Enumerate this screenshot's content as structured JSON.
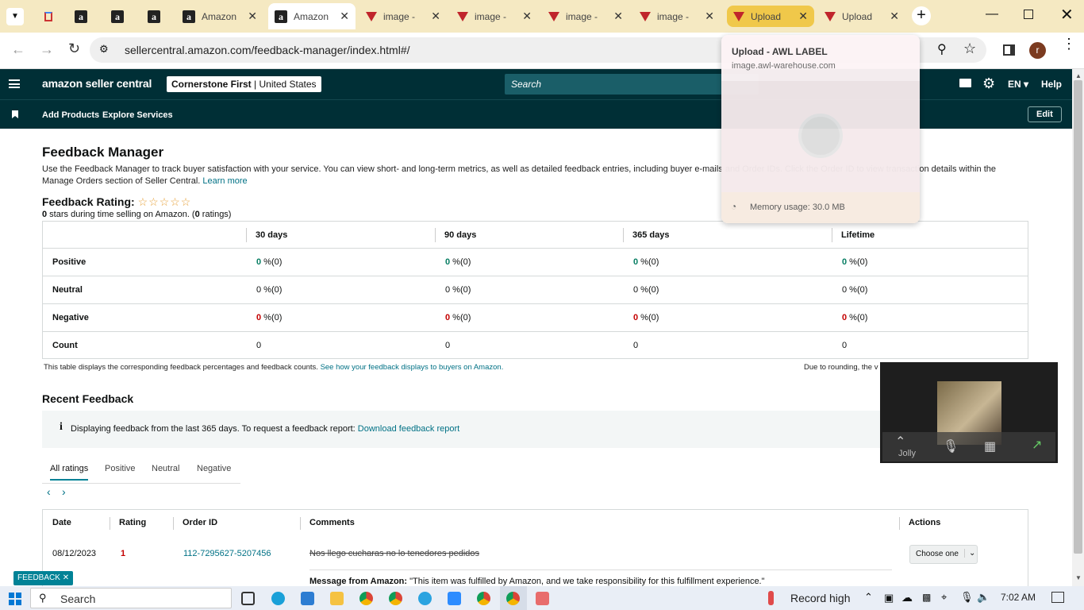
{
  "browser": {
    "tabs": [
      {
        "label": "",
        "icon": "gmail-icon"
      },
      {
        "label": "",
        "icon": "amazon-icon"
      },
      {
        "label": "",
        "icon": "amazon-icon"
      },
      {
        "label": "",
        "icon": "amazon-icon"
      },
      {
        "label": "Amazon",
        "icon": "amazon-icon"
      },
      {
        "label": "Amazon",
        "icon": "amazon-icon",
        "active": true
      },
      {
        "label": "image -",
        "icon": "awl-icon"
      },
      {
        "label": "image -",
        "icon": "awl-icon"
      },
      {
        "label": "image -",
        "icon": "awl-icon"
      },
      {
        "label": "image -",
        "icon": "awl-icon"
      },
      {
        "label": "Upload",
        "icon": "awl-icon",
        "highlighted": true
      },
      {
        "label": "Upload",
        "icon": "awl-icon"
      }
    ],
    "url": "sellercentral.amazon.com/feedback-manager/index.html#/",
    "profile_initial": "r"
  },
  "tab_preview": {
    "title": "Upload - AWL LABEL",
    "domain": "image.awl-warehouse.com",
    "memory": "Memory usage: 30.0 MB"
  },
  "seller_nav": {
    "logo": "amazon seller central",
    "store_name": "Cornerstone First",
    "store_region": "United States",
    "search_placeholder": "Search",
    "lang": "EN",
    "help": "Help",
    "links": [
      "Add Products",
      "Explore Services"
    ],
    "edit": "Edit"
  },
  "page": {
    "title": "Feedback Manager",
    "intro": "Use the Feedback Manager to track buyer satisfaction with your service. You can view short- and long-term metrics, as well as detailed feedback entries, including buyer e-mails and Order IDs. Click the Order ID to view transaction details within the Manage Orders section of Seller Central.",
    "learn_more": "Learn more",
    "rating_label": "Feedback Rating:",
    "rating_stars": 0,
    "rating_count_strong": "0",
    "rating_mid": " stars during time selling on Amazon. (",
    "rating_count2": "0",
    "rating_end": " ratings)"
  },
  "metrics": {
    "columns": [
      "30 days",
      "90 days",
      "365 days",
      "Lifetime"
    ],
    "rows": [
      {
        "label": "Positive",
        "cells": [
          [
            "0",
            " %(0)"
          ],
          [
            "0",
            " %(0)"
          ],
          [
            "0",
            " %(0)"
          ],
          [
            "0",
            " %(0)"
          ]
        ],
        "tone": "green"
      },
      {
        "label": "Neutral",
        "cells": [
          [
            "0",
            " %(0)"
          ],
          [
            "0",
            " %(0)"
          ],
          [
            "0",
            " %(0)"
          ],
          [
            "0",
            " %(0)"
          ]
        ],
        "tone": "plain"
      },
      {
        "label": "Negative",
        "cells": [
          [
            "0",
            " %(0)"
          ],
          [
            "0",
            " %(0)"
          ],
          [
            "0",
            " %(0)"
          ],
          [
            "0",
            " %(0)"
          ]
        ],
        "tone": "red"
      },
      {
        "label": "Count",
        "cells": [
          [
            "0",
            ""
          ],
          [
            "0",
            ""
          ],
          [
            "0",
            ""
          ],
          [
            "0",
            ""
          ]
        ],
        "tone": "count"
      }
    ],
    "footnote": "This table displays the corresponding feedback percentages and feedback counts.",
    "footnote_link": "See how your feedback displays to buyers on Amazon.",
    "rounding_note": "Due to rounding, the v"
  },
  "recent": {
    "title": "Recent Feedback",
    "info_text": "Displaying feedback from the last 365 days. To request a feedback report:",
    "info_link": "Download feedback report",
    "tabs": [
      "All ratings",
      "Positive",
      "Neutral",
      "Negative"
    ],
    "columns": [
      "Date",
      "Rating",
      "Order ID",
      "Comments",
      "Actions"
    ],
    "rows": [
      {
        "date": "08/12/2023",
        "rating": "1",
        "order_id": "112-7295627-5207456",
        "comment": "Nos llego cucharas no lo tenedores pedidos",
        "message_label": "Message from Amazon:",
        "message": "\"This item was fulfilled by Amazon, and we take responsibility for this fulfillment experience.\"",
        "action": "Choose one"
      }
    ]
  },
  "feedback_tab": "FEEDBACK",
  "video": {
    "name": "Jolly"
  },
  "taskbar": {
    "search": "Search",
    "weather": "Record high",
    "time": "7:02 AM"
  },
  "colors": {
    "nav": "#002f36",
    "link": "#007185",
    "positive": "#067d62",
    "negative": "#c40000",
    "tabbar": "#f5e9c2"
  }
}
